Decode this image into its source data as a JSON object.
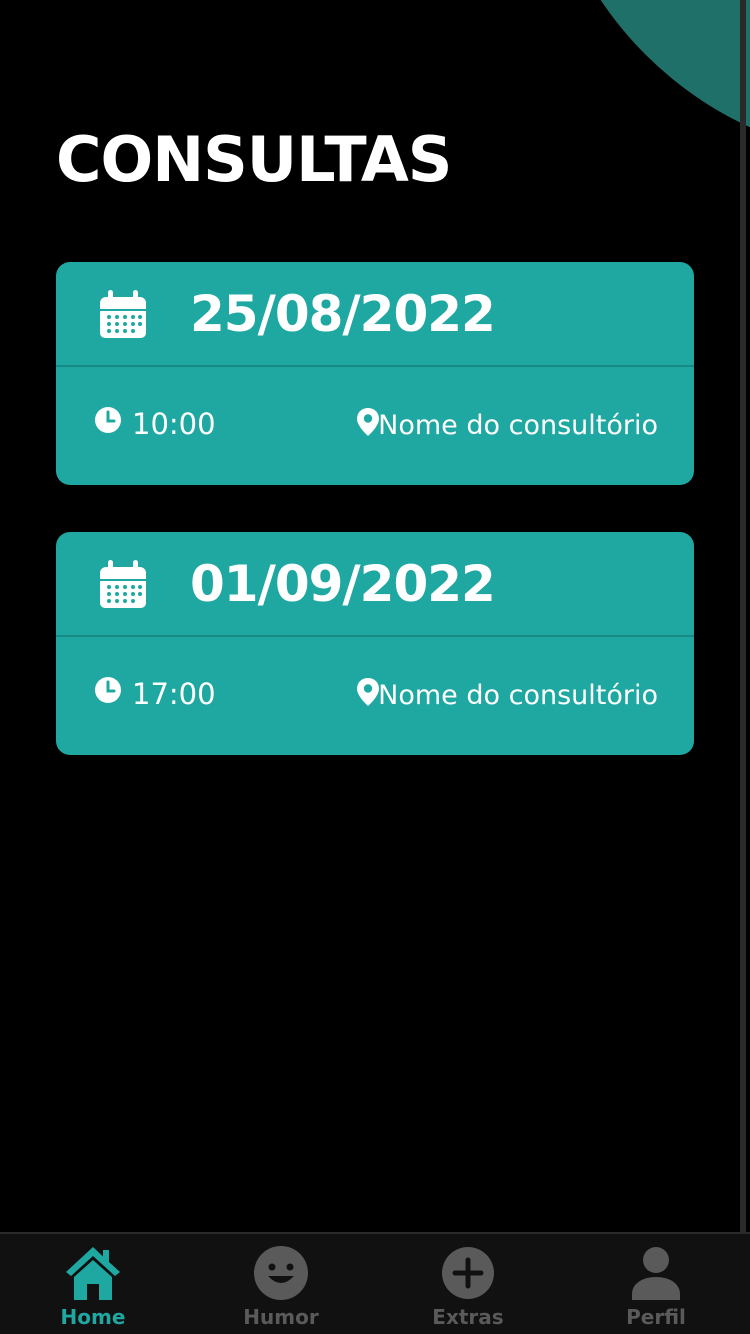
{
  "page": {
    "title": "CONSULTAS"
  },
  "appointments": [
    {
      "date": "25/08/2022",
      "time": "10:00",
      "place": "Nome do consultório"
    },
    {
      "date": "01/09/2022",
      "time": "17:00",
      "place": "Nome do consultório"
    }
  ],
  "nav": {
    "items": [
      {
        "label": "Home",
        "icon": "home-icon",
        "active": true
      },
      {
        "label": "Humor",
        "icon": "smiley-icon",
        "active": false
      },
      {
        "label": "Extras",
        "icon": "plus-circle-icon",
        "active": false
      },
      {
        "label": "Perfil",
        "icon": "user-icon",
        "active": false
      }
    ]
  },
  "colors": {
    "background": "#000000",
    "card": "#1fa8a1",
    "accent_active": "#1fa8a1",
    "nav_inactive": "#5a5a5a",
    "corner_decoration": "#20706a"
  }
}
